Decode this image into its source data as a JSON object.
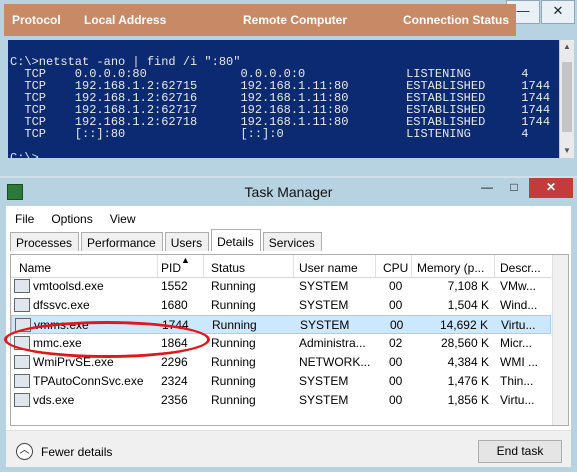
{
  "console": {
    "lines": [
      "C:\\>netstat -ano | find /i \":80\"",
      "  TCP    0.0.0.0:80             0.0.0.0:0              LISTENING       4",
      "  TCP    192.168.1.2:62715      192.168.1.11:80        ESTABLISHED     1744",
      "  TCP    192.168.1.2:62716      192.168.1.11:80        ESTABLISHED     1744",
      "  TCP    192.168.1.2:62717      192.168.1.11:80        ESTABLISHED     1744",
      "  TCP    192.168.1.2:62718      192.168.1.11:80        ESTABLISHED     1744",
      "  TCP    [::]:80                [::]:0                 LISTENING       4",
      "",
      "C:\\>"
    ],
    "header": {
      "protocol": "Protocol",
      "local": "Local Address",
      "remote": "Remote Computer",
      "status": "Connection Status"
    },
    "controls": {
      "minimize": "—",
      "close": "✕"
    }
  },
  "taskmanager": {
    "title": "Task Manager",
    "controls": {
      "minimize": "—",
      "maximize": "□",
      "close": "✕"
    },
    "menu": [
      "File",
      "Options",
      "View"
    ],
    "tabs": [
      "Processes",
      "Performance",
      "Users",
      "Details",
      "Services"
    ],
    "active_tab": "Details",
    "columns": [
      "Name",
      "PID",
      "Status",
      "User name",
      "CPU",
      "Memory (p...",
      "Descr..."
    ],
    "rows": [
      {
        "name": "vmtoolsd.exe",
        "pid": "1552",
        "status": "Running",
        "user": "SYSTEM",
        "cpu": "00",
        "mem": "7,108 K",
        "desc": "VMw..."
      },
      {
        "name": "dfssvc.exe",
        "pid": "1680",
        "status": "Running",
        "user": "SYSTEM",
        "cpu": "00",
        "mem": "1,504 K",
        "desc": "Wind..."
      },
      {
        "name": "vmms.exe",
        "pid": "1744",
        "status": "Running",
        "user": "SYSTEM",
        "cpu": "00",
        "mem": "14,692 K",
        "desc": "Virtu..."
      },
      {
        "name": "mmc.exe",
        "pid": "1864",
        "status": "Running",
        "user": "Administra...",
        "cpu": "02",
        "mem": "28,560 K",
        "desc": "Micr..."
      },
      {
        "name": "WmiPrvSE.exe",
        "pid": "2296",
        "status": "Running",
        "user": "NETWORK...",
        "cpu": "00",
        "mem": "4,384 K",
        "desc": "WMI ..."
      },
      {
        "name": "TPAutoConnSvc.exe",
        "pid": "2324",
        "status": "Running",
        "user": "SYSTEM",
        "cpu": "00",
        "mem": "1,476 K",
        "desc": "Thin..."
      },
      {
        "name": "vds.exe",
        "pid": "2356",
        "status": "Running",
        "user": "SYSTEM",
        "cpu": "00",
        "mem": "1,856 K",
        "desc": "Virtu..."
      }
    ],
    "fewer_details": "Fewer details",
    "end_task": "End task"
  }
}
